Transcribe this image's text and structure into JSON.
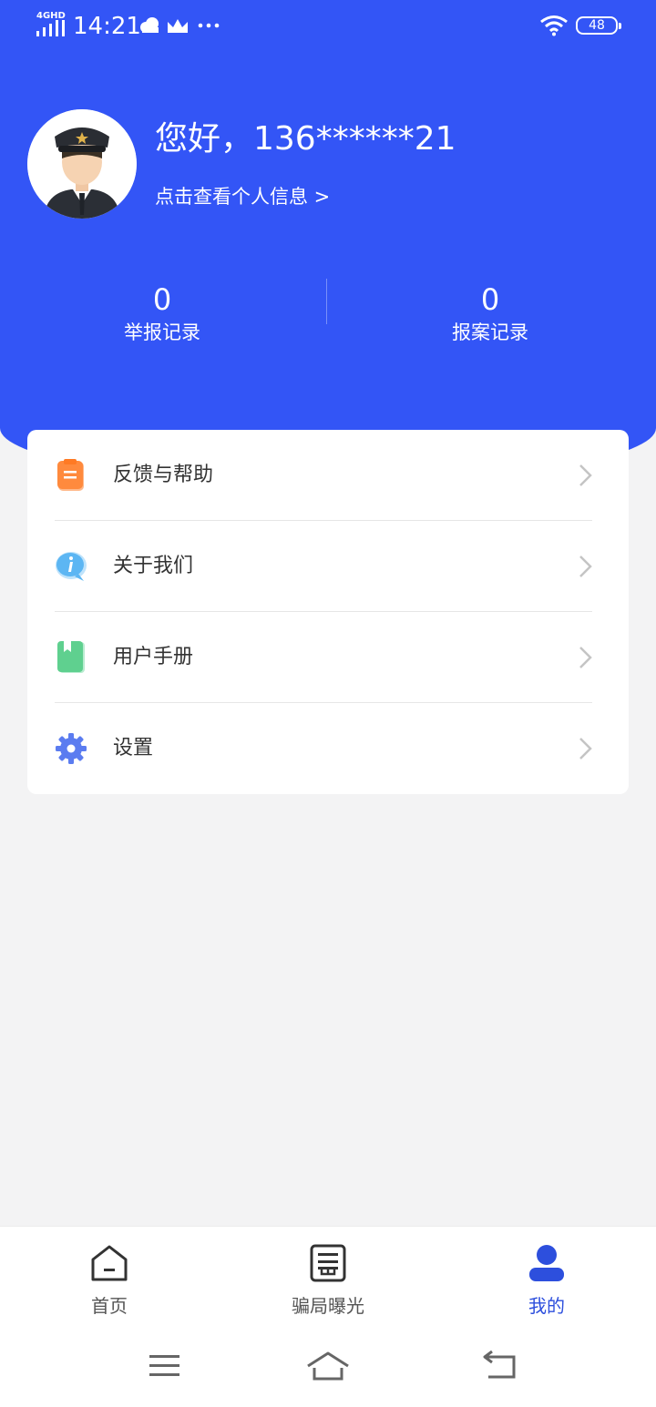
{
  "status_bar": {
    "network": "4GHD",
    "time": "14:21",
    "battery": "48"
  },
  "profile": {
    "greeting": "您好，136******21",
    "link_text": "点击查看个人信息 >"
  },
  "stats": [
    {
      "value": "0",
      "label": "举报记录"
    },
    {
      "value": "0",
      "label": "报案记录"
    }
  ],
  "menu": {
    "items": [
      {
        "label": "反馈与帮助",
        "icon": "clipboard-icon"
      },
      {
        "label": "关于我们",
        "icon": "info-bubble-icon"
      },
      {
        "label": "用户手册",
        "icon": "book-icon"
      },
      {
        "label": "设置",
        "icon": "gear-icon"
      }
    ]
  },
  "tab_bar": {
    "tabs": [
      {
        "label": "首页",
        "icon": "home-icon",
        "active": false
      },
      {
        "label": "骗局曝光",
        "icon": "news-icon",
        "active": false
      },
      {
        "label": "我的",
        "icon": "user-icon",
        "active": true
      }
    ]
  },
  "colors": {
    "primary": "#3355f6",
    "active_tab": "#2d4fdd",
    "background": "#f3f3f4"
  }
}
